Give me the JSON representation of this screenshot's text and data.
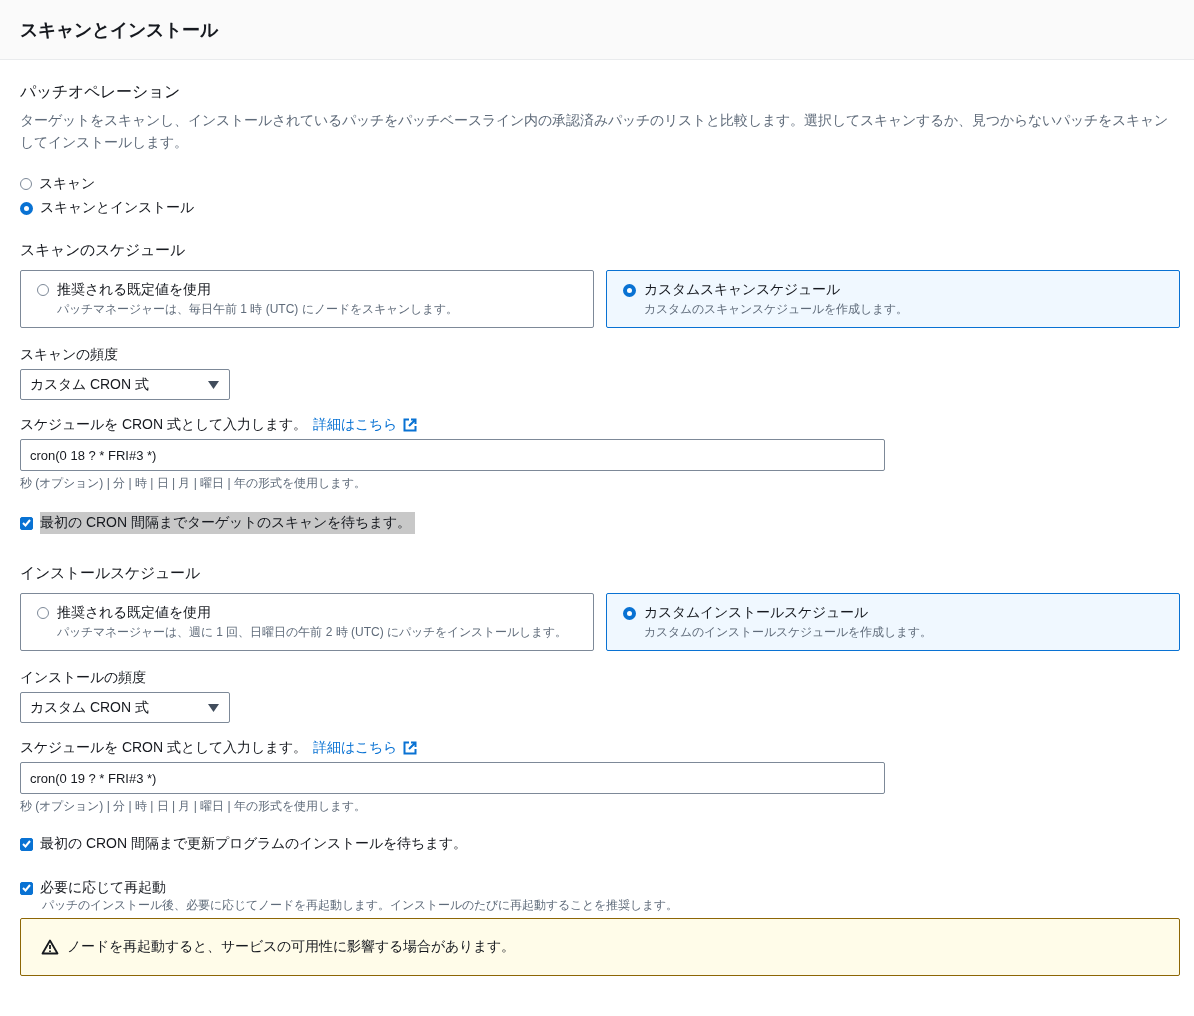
{
  "header": {
    "title": "スキャンとインストール"
  },
  "operation": {
    "title": "パッチオペレーション",
    "description": "ターゲットをスキャンし、インストールされているパッチをパッチベースライン内の承認済みパッチのリストと比較します。選択してスキャンするか、見つからないパッチをスキャンしてインストールします。",
    "options": [
      {
        "label": "スキャン",
        "selected": false
      },
      {
        "label": "スキャンとインストール",
        "selected": true
      }
    ]
  },
  "scan": {
    "title": "スキャンのスケジュール",
    "cards": [
      {
        "label": "推奨される既定値を使用",
        "description": "パッチマネージャーは、毎日午前 1 時 (UTC) にノードをスキャンします。",
        "selected": false
      },
      {
        "label": "カスタムスキャンスケジュール",
        "description": "カスタムのスキャンスケジュールを作成します。",
        "selected": true
      }
    ],
    "frequency": {
      "label": "スキャンの頻度",
      "value": "カスタム CRON 式"
    },
    "cron": {
      "label": "スケジュールを CRON 式として入力します。",
      "link": "詳細はこちら",
      "value": "cron(0 18 ? * FRI#3 *)",
      "hint": "秒 (オプション) | 分 | 時 | 日 | 月 | 曜日 | 年の形式を使用します。"
    },
    "wait": {
      "label": "最初の CRON 間隔までターゲットのスキャンを待ちます。",
      "checked": true,
      "highlighted": true
    }
  },
  "install": {
    "title": "インストールスケジュール",
    "cards": [
      {
        "label": "推奨される既定値を使用",
        "description": "パッチマネージャーは、週に 1 回、日曜日の午前 2 時 (UTC) にパッチをインストールします。",
        "selected": false
      },
      {
        "label": "カスタムインストールスケジュール",
        "description": "カスタムのインストールスケジュールを作成します。",
        "selected": true
      }
    ],
    "frequency": {
      "label": "インストールの頻度",
      "value": "カスタム CRON 式"
    },
    "cron": {
      "label": "スケジュールを CRON 式として入力します。",
      "link": "詳細はこちら",
      "value": "cron(0 19 ? * FRI#3 *)",
      "hint": "秒 (オプション) | 分 | 時 | 日 | 月 | 曜日 | 年の形式を使用します。"
    },
    "wait": {
      "label": "最初の CRON 間隔まで更新プログラムのインストールを待ちます。",
      "checked": true,
      "highlighted": false
    }
  },
  "reboot": {
    "label": "必要に応じて再起動",
    "checked": true,
    "description": "パッチのインストール後、必要に応じてノードを再起動します。インストールのたびに再起動することを推奨します。"
  },
  "warning": {
    "text": "ノードを再起動すると、サービスの可用性に影響する場合があります。"
  }
}
